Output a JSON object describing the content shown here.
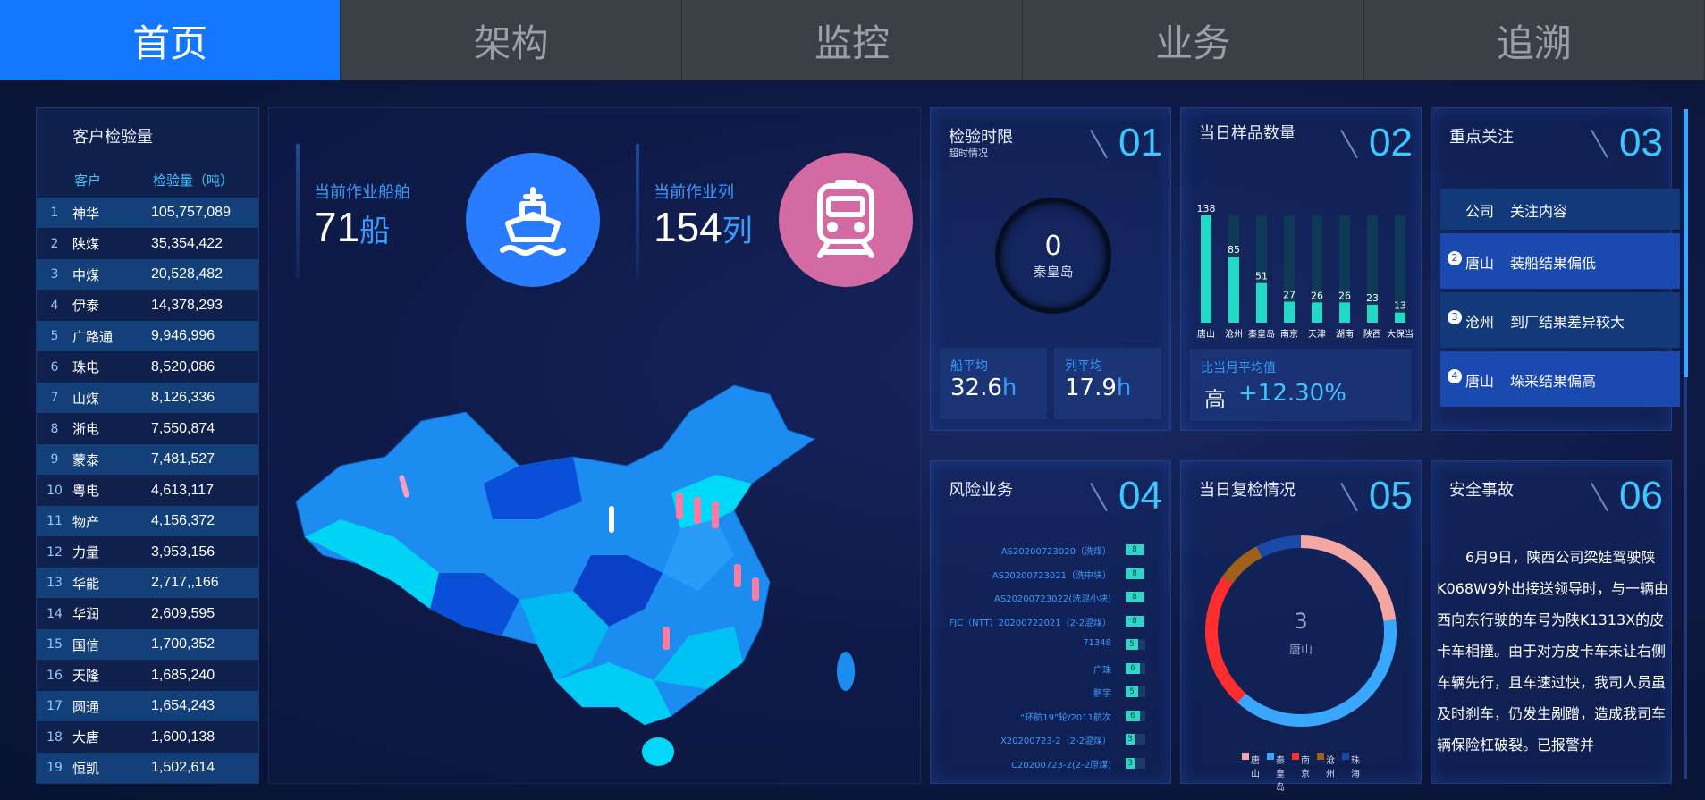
{
  "nav": {
    "tabs": [
      "首页",
      "架构",
      "监控",
      "业务",
      "追溯"
    ],
    "active": 0
  },
  "customer": {
    "title": "客户检验量",
    "col_customer": "客户",
    "col_amount": "检验量（吨）",
    "rows": [
      {
        "idx": "1",
        "name": "神华",
        "value": "105,757,089"
      },
      {
        "idx": "2",
        "name": "陕煤",
        "value": "35,354,422"
      },
      {
        "idx": "3",
        "name": "中煤",
        "value": "20,528,482"
      },
      {
        "idx": "4",
        "name": "伊泰",
        "value": "14,378,293"
      },
      {
        "idx": "5",
        "name": "广路通",
        "value": "9,946,996"
      },
      {
        "idx": "6",
        "name": "珠电",
        "value": "8,520,086"
      },
      {
        "idx": "7",
        "name": "山煤",
        "value": "8,126,336"
      },
      {
        "idx": "8",
        "name": "浙电",
        "value": "7,550,874"
      },
      {
        "idx": "9",
        "name": "蒙泰",
        "value": "7,481,527"
      },
      {
        "idx": "10",
        "name": "粤电",
        "value": "4,613,117"
      },
      {
        "idx": "11",
        "name": "物产",
        "value": "4,156,372"
      },
      {
        "idx": "12",
        "name": "力量",
        "value": "3,953,156"
      },
      {
        "idx": "13",
        "name": "华能",
        "value": "2,717,,166"
      },
      {
        "idx": "14",
        "name": "华润",
        "value": "2,609,595"
      },
      {
        "idx": "15",
        "name": "国信",
        "value": "1,700,352"
      },
      {
        "idx": "16",
        "name": "天隆",
        "value": "1,685,240"
      },
      {
        "idx": "17",
        "name": "圆通",
        "value": "1,654,243"
      },
      {
        "idx": "18",
        "name": "大唐",
        "value": "1,600,138"
      },
      {
        "idx": "19",
        "name": "恒凯",
        "value": "1,502,614"
      }
    ]
  },
  "map": {
    "ship_label": "当前作业船舶",
    "ship_value": "71",
    "ship_unit": "船",
    "train_label": "当前作业列",
    "train_value": "154",
    "train_unit": "列"
  },
  "p01": {
    "title": "检验时限",
    "subtitle": "超时情况",
    "num": "01",
    "gauge_value": "0",
    "gauge_label": "秦皇岛",
    "ship_avg_label": "船平均",
    "ship_avg_value": "32.6",
    "ship_avg_unit": "h",
    "train_avg_label": "列平均",
    "train_avg_value": "17.9",
    "train_avg_unit": "h"
  },
  "p02": {
    "title": "当日样品数量",
    "num": "02",
    "compare_label": "比当月平均值",
    "level": "高",
    "change": "+12.30%"
  },
  "p03": {
    "title": "重点关注",
    "num": "03",
    "col_company": "公司",
    "col_content": "关注内容",
    "rows": [
      {
        "n": "2",
        "company": "唐山",
        "content": "装船结果偏低"
      },
      {
        "n": "3",
        "company": "沧州",
        "content": "到厂结果差异较大"
      },
      {
        "n": "4",
        "company": "唐山",
        "content": "垛采结果偏高"
      }
    ]
  },
  "p04": {
    "title": "风险业务",
    "num": "04",
    "rows": [
      {
        "label": "AS20200723020（洗煤）",
        "v": "8"
      },
      {
        "label": "AS20200723021（洗中块）",
        "v": "8"
      },
      {
        "label": "AS20200723022(洗混小块)",
        "v": "8"
      },
      {
        "label": "FJC（NTT）20200722021（2-2混煤）",
        "v": "8"
      },
      {
        "label": "71348",
        "v": "5"
      },
      {
        "label": "广珠",
        "v": "6"
      },
      {
        "label": "鹏宇",
        "v": "5"
      },
      {
        "label": "“环航19”轮/2011航次",
        "v": "6"
      },
      {
        "label": "X20200723-2（2-2混煤）",
        "v": "3"
      },
      {
        "label": "C20200723-2(2-2原煤)",
        "v": "3"
      }
    ]
  },
  "p05": {
    "title": "当日复检情况",
    "num": "05",
    "center_value": "3",
    "center_label": "唐山",
    "legend": [
      {
        "name": "唐山",
        "color": "#f4a6a0"
      },
      {
        "name": "秦皇岛",
        "color": "#3aa7ff"
      },
      {
        "name": "南京",
        "color": "#ff2d2d"
      },
      {
        "name": "沧州",
        "color": "#a0601a"
      },
      {
        "name": "珠海",
        "color": "#1a4aa8"
      }
    ],
    "ring": [
      {
        "name": "唐山",
        "value": 3
      },
      {
        "name": "秦皇岛",
        "value": 5
      },
      {
        "name": "南京",
        "value": 3
      },
      {
        "name": "沧州",
        "value": 1
      },
      {
        "name": "珠海",
        "value": 1
      }
    ]
  },
  "p06": {
    "title": "安全事故",
    "num": "06",
    "text": "6月9日，陕西公司梁娃驾驶陕K068W9外出接送领导时，与一辆由西向东行驶的车号为陕K1313X的皮卡车相撞。由于对方皮卡车未让右侧车辆先行，且车速过快，我司人员虽及时刹车，仍发生剐蹭，造成我司车辆保险杠破裂。已报警并"
  },
  "chart_data": {
    "type": "bar",
    "categories": [
      "唐山",
      "沧州",
      "秦皇岛",
      "南京",
      "天津",
      "湖南",
      "陕西",
      "大保当"
    ],
    "values": [
      138,
      85,
      51,
      27,
      26,
      26,
      23,
      13
    ],
    "ylim": [
      0,
      138
    ]
  }
}
